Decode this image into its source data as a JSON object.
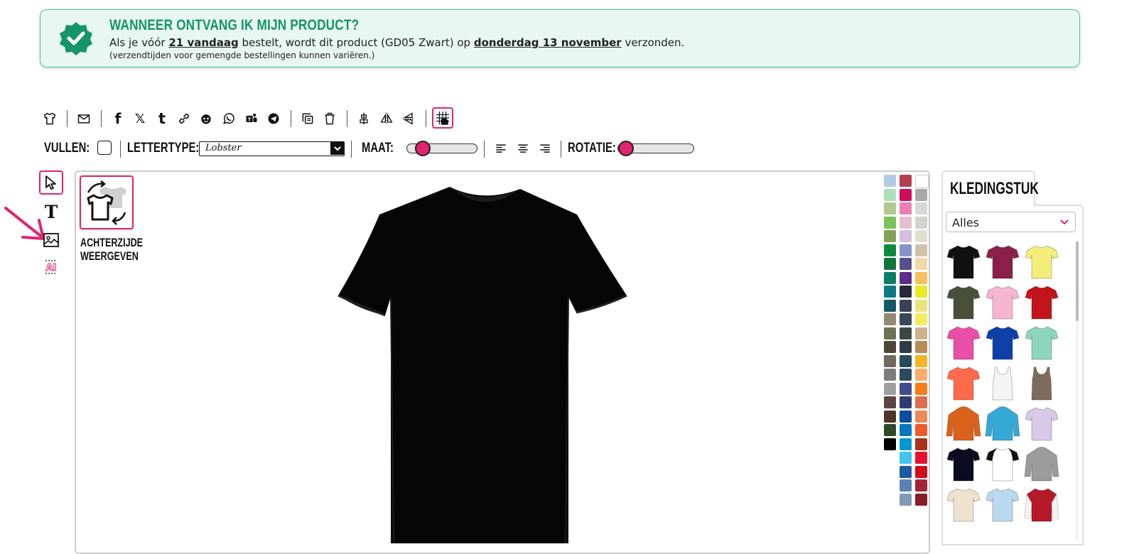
{
  "banner": {
    "title": "WANNEER ONTVANG IK MIJN PRODUCT?",
    "line_prefix": "Als je vóór ",
    "deadline": "21 vandaag",
    "line_middle": " bestelt, wordt dit product (GD05 Zwart) op ",
    "ship_date": "donderdag 13 november",
    "line_suffix": " verzonden.",
    "note": "(verzendtijden voor gemengde bestellingen kunnen variëren.)",
    "accent": "#16946a",
    "background": "#e8f7f1"
  },
  "toolbar": {
    "icons": [
      "tshirt-icon",
      "email-icon",
      "facebook-icon",
      "x-icon",
      "tumblr-icon",
      "link-icon",
      "reddit-icon",
      "whatsapp-icon",
      "teams-icon",
      "telegram-icon",
      "copy-icon",
      "trash-icon",
      "center-icon",
      "flip-horizontal-icon",
      "flip-vertical-icon",
      "grid-icon"
    ],
    "facebook": "f",
    "x": "𝕏",
    "tumblr": "t"
  },
  "properties": {
    "fill_label": "VULLEN:",
    "font_label": "LETTERTYPE:",
    "font_value": "Lobster",
    "size_label": "MAAT:",
    "size_value": 0.16,
    "rotation_label": "ROTATIE:",
    "rotation_value": 0.0
  },
  "tools": {
    "text_glyph": "T",
    "ai_glyph": "AI"
  },
  "canvas": {
    "back_label_line1": "ACHTERZIJDE",
    "back_label_line2": "WEERGEVEN",
    "product_color": "#000000",
    "accent": "#e0246f"
  },
  "palette": {
    "col1": [
      "#b0cbe3",
      "#b1deba",
      "#b0c98e",
      "#78c35b",
      "#84a35a",
      "#0d8a3c",
      "#11743d",
      "#0b7f66",
      "#0e7a88",
      "#155a65",
      "#958a70",
      "#6d7357",
      "#4f4838",
      "#72685d",
      "#7c7c7c",
      "#9fa0a0",
      "#5b4644",
      "#4f3529",
      "#2e4a27",
      "#000000"
    ],
    "col2": [
      "#b43e4f",
      "#cf0b5c",
      "#ee7db0",
      "#e3bfce",
      "#d2bfde",
      "#8793c8",
      "#554f8e",
      "#5b2d8a",
      "#27293a",
      "#3c4057",
      "#354a57",
      "#3a4743",
      "#313a44",
      "#274b5b",
      "#2a4a5e",
      "#3f4b8d",
      "#2e3b75",
      "#0b4d9e",
      "#0078bd",
      "#0099cf",
      "#44c3ee",
      "#1e5ba5",
      "#5b81b7",
      "#7f9bb6"
    ],
    "col3": [
      "#ffffff",
      "#a8a8a8",
      "#d9d9d9",
      "#d3d3cf",
      "#e2dfd0",
      "#cfc2a6",
      "#f1d9a8",
      "#f5c15a",
      "#e7ec22",
      "#e7e47b",
      "#f6ec5b",
      "#cdb38b",
      "#b78c5b",
      "#f5b325",
      "#fbac6c",
      "#f87d16",
      "#e06d4d",
      "#ee8a58",
      "#f15a2d",
      "#ab321c",
      "#e8112d",
      "#d20a1d",
      "#a52435",
      "#8a1c24"
    ]
  },
  "garments": {
    "tab_label": "KLEDINGSTUK",
    "filter_value": "Alles",
    "items": [
      {
        "type": "tshirt",
        "color": "#111111"
      },
      {
        "type": "tshirt",
        "color": "#8a1f4a"
      },
      {
        "type": "tshirt",
        "color": "#f3ee7a"
      },
      {
        "type": "tshirt",
        "color": "#4a4f3a"
      },
      {
        "type": "tshirt",
        "color": "#f6b6cf"
      },
      {
        "type": "tshirt",
        "color": "#c4141b"
      },
      {
        "type": "tshirt",
        "color": "#e94fa6"
      },
      {
        "type": "tshirt",
        "color": "#0f3fa8"
      },
      {
        "type": "tshirt",
        "color": "#8ed5be"
      },
      {
        "type": "tshirt",
        "color": "#ff6a4d"
      },
      {
        "type": "tank",
        "color": "#f4f4f4"
      },
      {
        "type": "tank",
        "color": "#7d6b5c"
      },
      {
        "type": "hoodie",
        "color": "#d9621d"
      },
      {
        "type": "hoodie",
        "color": "#35a9d6"
      },
      {
        "type": "tshirt",
        "color": "#d8c9e6"
      },
      {
        "type": "tshirt",
        "color": "#0c0c20"
      },
      {
        "type": "raglan",
        "color": "#ffffff"
      },
      {
        "type": "hoodie",
        "color": "#9c9c9c"
      },
      {
        "type": "tshirt",
        "color": "#efe3cf"
      },
      {
        "type": "tshirt",
        "color": "#b8d9ee"
      },
      {
        "type": "jacket",
        "color": "#b51a2a"
      }
    ]
  }
}
